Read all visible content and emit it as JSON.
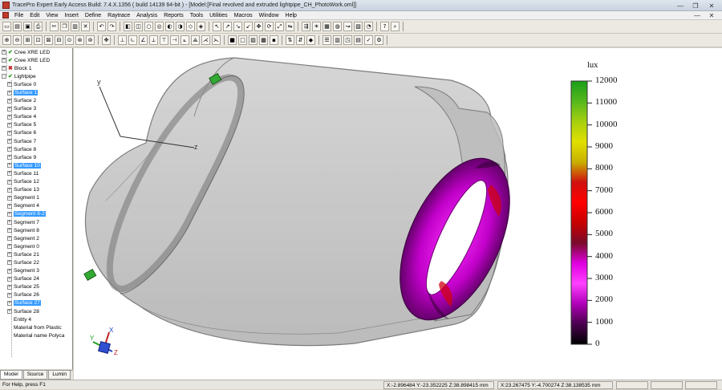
{
  "window": {
    "title": "TracePro Expert    Early Access Build: 7.4.X.1356    ( build 14139 64-bit )   - [Model:[Final revolved and extruded lightpipe_CH_PhotoWork.oml]]"
  },
  "menu": [
    "File",
    "Edit",
    "View",
    "Insert",
    "Define",
    "Raytrace",
    "Analysis",
    "Reports",
    "Tools",
    "Utilities",
    "Macros",
    "Window",
    "Help"
  ],
  "toolbar1": {
    "group1": [
      {
        "icon": "new-file-icon",
        "glyph": "▭"
      },
      {
        "icon": "open-folder-icon",
        "glyph": "▤"
      },
      {
        "icon": "save-icon",
        "glyph": "▣"
      },
      {
        "icon": "print-icon",
        "glyph": "⎙"
      }
    ],
    "group2": [
      {
        "icon": "cut-icon",
        "glyph": "✂"
      },
      {
        "icon": "copy-icon",
        "glyph": "❐"
      },
      {
        "icon": "paste-icon",
        "glyph": "▥"
      },
      {
        "icon": "delete-icon",
        "glyph": "✕"
      }
    ],
    "group3": [
      {
        "icon": "undo-icon",
        "glyph": "↶"
      },
      {
        "icon": "redo-icon",
        "glyph": "↷"
      }
    ],
    "group4": [
      {
        "icon": "box-primitive-icon",
        "glyph": "◧"
      },
      {
        "icon": "cylinder-primitive-icon",
        "glyph": "◫"
      },
      {
        "icon": "sphere-primitive-icon",
        "glyph": "○"
      },
      {
        "icon": "torus-primitive-icon",
        "glyph": "◎"
      },
      {
        "icon": "lens-primitive-icon",
        "glyph": "◐"
      },
      {
        "icon": "reflector-icon",
        "glyph": "◑"
      },
      {
        "icon": "surface-icon",
        "glyph": "◇"
      },
      {
        "icon": "wireframe-icon",
        "glyph": "◈"
      }
    ],
    "group5": [
      {
        "icon": "select-arrow-icon",
        "glyph": "↖"
      },
      {
        "icon": "select-surface-icon",
        "glyph": "↗"
      },
      {
        "icon": "select-edge-icon",
        "glyph": "↘"
      },
      {
        "icon": "select-vertex-icon",
        "glyph": "↙"
      },
      {
        "icon": "move-icon",
        "glyph": "✥"
      },
      {
        "icon": "rotate-icon",
        "glyph": "⟳"
      },
      {
        "icon": "scale-icon",
        "glyph": "⤢"
      },
      {
        "icon": "mirror-icon",
        "glyph": "⇋"
      }
    ],
    "group6": [
      {
        "icon": "trace-rays-icon",
        "glyph": "⇶"
      },
      {
        "icon": "source-icon",
        "glyph": "☀"
      },
      {
        "icon": "grid-source-icon",
        "glyph": "▦"
      },
      {
        "icon": "surface-source-icon",
        "glyph": "◍"
      },
      {
        "icon": "ray-display-icon",
        "glyph": "↝"
      },
      {
        "icon": "irradiance-icon",
        "glyph": "▧"
      },
      {
        "icon": "candela-icon",
        "glyph": "◔"
      }
    ],
    "group7": [
      {
        "icon": "help-icon",
        "glyph": "?"
      },
      {
        "icon": "context-help-icon",
        "glyph": "⌕"
      }
    ]
  },
  "toolbar2": {
    "group1": [
      {
        "icon": "zoom-in-icon",
        "glyph": "⊕"
      },
      {
        "icon": "zoom-out-icon",
        "glyph": "⊖"
      },
      {
        "icon": "zoom-window-icon",
        "glyph": "⊞"
      },
      {
        "icon": "zoom-fit-icon",
        "glyph": "⊡"
      },
      {
        "icon": "zoom-selection-icon",
        "glyph": "⊠"
      },
      {
        "icon": "zoom-previous-icon",
        "glyph": "⊟"
      },
      {
        "icon": "zoom-all-icon",
        "glyph": "⊙"
      },
      {
        "icon": "zoom-dynamic-icon",
        "glyph": "⊛"
      },
      {
        "icon": "zoom-extents-icon",
        "glyph": "⊚"
      }
    ],
    "group2": [
      {
        "icon": "pan-icon",
        "glyph": "✥"
      }
    ],
    "group3": [
      {
        "icon": "view-xy-icon",
        "glyph": "⊥"
      },
      {
        "icon": "view-yz-icon",
        "glyph": "∟"
      },
      {
        "icon": "view-zx-icon",
        "glyph": "∠"
      },
      {
        "icon": "view-x-icon",
        "glyph": "⟂"
      },
      {
        "icon": "view-y-icon",
        "glyph": "⊤"
      },
      {
        "icon": "view-z-icon",
        "glyph": "⊣"
      },
      {
        "icon": "view-iso-icon",
        "glyph": "⟀"
      },
      {
        "icon": "view-dimetric-icon",
        "glyph": "⟁"
      },
      {
        "icon": "view-trimetric-icon",
        "glyph": "⋌"
      },
      {
        "icon": "view-orient-icon",
        "glyph": "⋋"
      }
    ],
    "group4": [
      {
        "icon": "render-solid-icon",
        "glyph": "■"
      },
      {
        "icon": "render-wireframe-icon",
        "glyph": "□"
      },
      {
        "icon": "render-hidden-line-icon",
        "glyph": "▨"
      },
      {
        "icon": "render-silhouette-icon",
        "glyph": "▩"
      },
      {
        "icon": "render-shaded-icon",
        "glyph": "▪"
      }
    ],
    "group5": [
      {
        "icon": "ray-sort-icon",
        "glyph": "⇅"
      },
      {
        "icon": "ray-filter-icon",
        "glyph": "⇵"
      },
      {
        "icon": "ray-color-icon",
        "glyph": "◆"
      }
    ],
    "group6": [
      {
        "icon": "property-icon",
        "glyph": "☰"
      },
      {
        "icon": "material-icon",
        "glyph": "▥"
      },
      {
        "icon": "exit-surface-icon",
        "glyph": "◳"
      },
      {
        "icon": "prescription-icon",
        "glyph": "▤"
      },
      {
        "icon": "raytrace-options-icon",
        "glyph": "✓"
      },
      {
        "icon": "analysis-options-icon",
        "glyph": "⚙"
      }
    ]
  },
  "tree": {
    "items": [
      {
        "label": "Cree XRE LED",
        "level": 0,
        "expander": "+",
        "mark": "check",
        "selected": false
      },
      {
        "label": "Cree XRE LED",
        "level": 0,
        "expander": "+",
        "mark": "check",
        "selected": false
      },
      {
        "label": "Block 1",
        "level": 0,
        "expander": "+",
        "mark": "x",
        "selected": false
      },
      {
        "label": "Lightpipe",
        "level": 0,
        "expander": "-",
        "mark": "check",
        "selected": false
      },
      {
        "label": "Surface 0",
        "level": 1,
        "expander": "+",
        "mark": "",
        "selected": false
      },
      {
        "label": "Surface 1",
        "level": 1,
        "expander": "+",
        "mark": "",
        "selected": true
      },
      {
        "label": "Surface 2",
        "level": 1,
        "expander": "+",
        "mark": "",
        "selected": false
      },
      {
        "label": "Surface 3",
        "level": 1,
        "expander": "+",
        "mark": "",
        "selected": false
      },
      {
        "label": "Surface 4",
        "level": 1,
        "expander": "+",
        "mark": "",
        "selected": false
      },
      {
        "label": "Surface 5",
        "level": 1,
        "expander": "+",
        "mark": "",
        "selected": false
      },
      {
        "label": "Surface 6",
        "level": 1,
        "expander": "+",
        "mark": "",
        "selected": false
      },
      {
        "label": "Surface 7",
        "level": 1,
        "expander": "+",
        "mark": "",
        "selected": false
      },
      {
        "label": "Surface 8",
        "level": 1,
        "expander": "+",
        "mark": "",
        "selected": false
      },
      {
        "label": "Surface 9",
        "level": 1,
        "expander": "+",
        "mark": "",
        "selected": false
      },
      {
        "label": "Surface 10",
        "level": 1,
        "expander": "+",
        "mark": "",
        "selected": true
      },
      {
        "label": "Surface 11",
        "level": 1,
        "expander": "+",
        "mark": "",
        "selected": false
      },
      {
        "label": "Surface 12",
        "level": 1,
        "expander": "+",
        "mark": "",
        "selected": false
      },
      {
        "label": "Surface 13",
        "level": 1,
        "expander": "+",
        "mark": "",
        "selected": false
      },
      {
        "label": "Segment 1",
        "level": 1,
        "expander": "+",
        "mark": "",
        "selected": false
      },
      {
        "label": "Segment 4",
        "level": 1,
        "expander": "+",
        "mark": "",
        "selected": false
      },
      {
        "label": "Segment 6-2",
        "level": 1,
        "expander": "+",
        "mark": "",
        "selected": true
      },
      {
        "label": "Segment 7",
        "level": 1,
        "expander": "+",
        "mark": "",
        "selected": false
      },
      {
        "label": "Segment 8",
        "level": 1,
        "expander": "+",
        "mark": "",
        "selected": false
      },
      {
        "label": "Segment 2",
        "level": 1,
        "expander": "+",
        "mark": "",
        "selected": false
      },
      {
        "label": "Segment 0",
        "level": 1,
        "expander": "+",
        "mark": "",
        "selected": false
      },
      {
        "label": "Surface 21",
        "level": 1,
        "expander": "+",
        "mark": "",
        "selected": false
      },
      {
        "label": "Surface 22",
        "level": 1,
        "expander": "+",
        "mark": "",
        "selected": false
      },
      {
        "label": "Segment 3",
        "level": 1,
        "expander": "+",
        "mark": "",
        "selected": false
      },
      {
        "label": "Surface 24",
        "level": 1,
        "expander": "+",
        "mark": "",
        "selected": false
      },
      {
        "label": "Surface 25",
        "level": 1,
        "expander": "+",
        "mark": "",
        "selected": false
      },
      {
        "label": "Surface 26",
        "level": 1,
        "expander": "+",
        "mark": "",
        "selected": false
      },
      {
        "label": "Surface 27",
        "level": 1,
        "expander": "+",
        "mark": "",
        "selected": true
      },
      {
        "label": "Surface 28",
        "level": 1,
        "expander": "+",
        "mark": "",
        "selected": false
      },
      {
        "label": "Entity 4",
        "level": 1,
        "expander": "",
        "mark": "",
        "selected": false
      },
      {
        "label": "Material from Plastic",
        "level": 1,
        "expander": "",
        "mark": "",
        "selected": false
      },
      {
        "label": "Material name Polyca",
        "level": 1,
        "expander": "",
        "mark": "",
        "selected": false
      }
    ]
  },
  "tabs": [
    "Model",
    "Source",
    "Lumin"
  ],
  "active_tab": 0,
  "viewport": {
    "axis_small": {
      "x": "x",
      "y": "y",
      "z": "z"
    },
    "axis_triad": {
      "x": "X",
      "y": "Y",
      "z": "Z"
    },
    "colorbar": {
      "unit": "lux",
      "ticks": [
        "12000",
        "11000",
        "10000",
        "9000",
        "8000",
        "7000",
        "6000",
        "5000",
        "4000",
        "3000",
        "2000",
        "1000",
        "0"
      ],
      "stops": [
        "#1a9e1a",
        "#55b81c",
        "#a6cf10",
        "#e0e000",
        "#c9b000",
        "#d01010",
        "#ff0000",
        "#c80000",
        "#7a0a2a",
        "#e000e0",
        "#ff40ff",
        "#b000b8",
        "#4a004e",
        "#000000"
      ]
    }
  },
  "status": {
    "help": "For Help, press F1",
    "coords1": "X:-2.896484  Y:-23.352225  Z:38.898415 mm",
    "coords2": "X:23.267475  Y:-4.700274  Z:38.138535 mm"
  }
}
